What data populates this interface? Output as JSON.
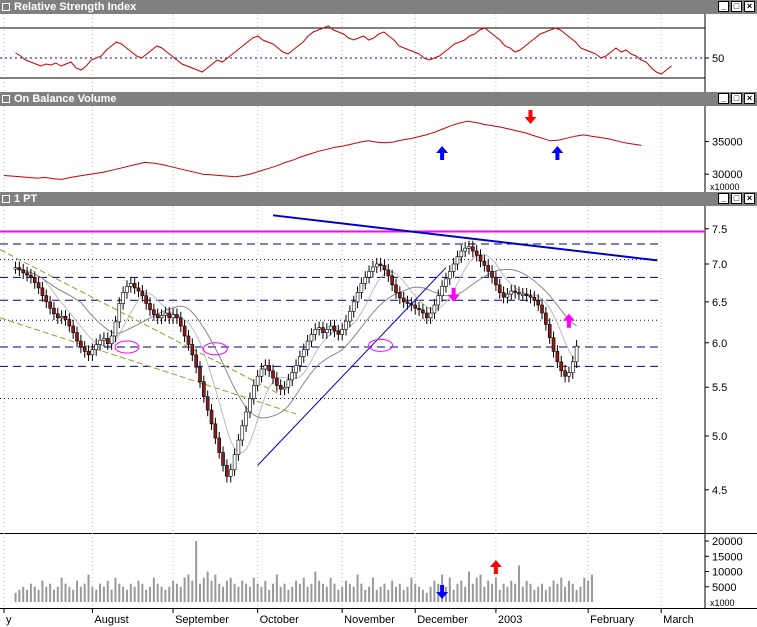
{
  "panels": {
    "rsi": {
      "title": "Relative Strength Index",
      "ticks": [
        {
          "v": 50,
          "label": "50"
        }
      ]
    },
    "obv": {
      "title": "On Balance Volume",
      "ticks": [
        {
          "v": 35000,
          "label": "35000"
        },
        {
          "v": 30000,
          "label": "30000"
        }
      ],
      "unit": "x10000"
    },
    "price": {
      "title": "1 PT",
      "ticks": [
        {
          "v": 7.5,
          "label": "7.5"
        },
        {
          "v": 7.0,
          "label": "7.0"
        },
        {
          "v": 6.5,
          "label": "6.5"
        },
        {
          "v": 6.0,
          "label": "6.0"
        },
        {
          "v": 5.5,
          "label": "5.5"
        },
        {
          "v": 5.0,
          "label": "5.0"
        },
        {
          "v": 4.5,
          "label": "4.5"
        }
      ]
    },
    "volume": {
      "ticks": [
        {
          "v": 20000,
          "label": "20000"
        },
        {
          "v": 15000,
          "label": "15000"
        },
        {
          "v": 10000,
          "label": "10000"
        },
        {
          "v": 5000,
          "label": "5000"
        }
      ],
      "unit": "x1000"
    }
  },
  "x_axis": {
    "months": [
      {
        "label": "y",
        "day": 0
      },
      {
        "label": "August",
        "day": 23
      },
      {
        "label": "September",
        "day": 44
      },
      {
        "label": "October",
        "day": 66
      },
      {
        "label": "November",
        "day": 88
      },
      {
        "label": "December",
        "day": 107
      },
      {
        "label": "2003",
        "day": 128
      },
      {
        "label": "February",
        "day": 152
      },
      {
        "label": "March",
        "day": 171
      }
    ]
  },
  "colors": {
    "rsi_line": "#cc0000",
    "obv_line": "#cc0000",
    "candle_up": "#ffffff",
    "candle_down": "#8b1a1a",
    "resistance": "#ff00ff",
    "trendline": "#0000cc",
    "channel": "#999933",
    "volume": "#999999",
    "arrow_blue": "#0000ff",
    "arrow_red": "#ff0000",
    "arrow_magenta": "#ff00ff"
  },
  "chart_data": {
    "type": "candlestick",
    "title": "1 PT",
    "days_total": 172,
    "ylim": [
      4.25,
      7.75
    ],
    "log_scale": true,
    "horizontal_lines": [
      {
        "v": 7.46,
        "style": "solid",
        "color": "magenta"
      },
      {
        "v": 7.28,
        "style": "dash"
      },
      {
        "v": 7.06,
        "style": "dot"
      },
      {
        "v": 6.82,
        "style": "dash"
      },
      {
        "v": 6.52,
        "style": "dash"
      },
      {
        "v": 6.27,
        "style": "dot"
      },
      {
        "v": 5.95,
        "style": "dash"
      },
      {
        "v": 5.73,
        "style": "dash"
      },
      {
        "v": 5.38,
        "style": "dot"
      }
    ],
    "price_close": [
      6.95,
      6.92,
      6.88,
      6.85,
      6.82,
      6.75,
      6.68,
      6.58,
      6.5,
      6.42,
      6.35,
      6.3,
      6.32,
      6.28,
      6.2,
      6.12,
      6.02,
      5.95,
      5.9,
      5.86,
      5.92,
      5.98,
      6.03,
      6.05,
      5.99,
      6.08,
      6.25,
      6.48,
      6.62,
      6.7,
      6.74,
      6.68,
      6.64,
      6.58,
      6.48,
      6.4,
      6.34,
      6.3,
      6.33,
      6.36,
      6.3,
      6.34,
      6.3,
      6.2,
      6.08,
      5.98,
      5.86,
      5.72,
      5.56,
      5.4,
      5.26,
      5.12,
      4.98,
      4.84,
      4.72,
      4.62,
      4.68,
      4.82,
      4.96,
      5.1,
      5.24,
      5.38,
      5.52,
      5.62,
      5.7,
      5.74,
      5.68,
      5.6,
      5.52,
      5.48,
      5.5,
      5.58,
      5.66,
      5.74,
      5.84,
      5.92,
      6.02,
      6.1,
      6.16,
      6.18,
      6.12,
      6.16,
      6.2,
      6.14,
      6.1,
      6.16,
      6.26,
      6.38,
      6.5,
      6.62,
      6.74,
      6.82,
      6.9,
      6.96,
      7.0,
      6.98,
      6.92,
      6.84,
      6.72,
      6.62,
      6.55,
      6.5,
      6.48,
      6.46,
      6.42,
      6.4,
      6.36,
      6.3,
      6.36,
      6.46,
      6.58,
      6.7,
      6.8,
      6.9,
      7.0,
      7.1,
      7.18,
      7.22,
      7.24,
      7.18,
      7.12,
      7.04,
      6.98,
      6.9,
      6.82,
      6.72,
      6.62,
      6.56,
      6.6,
      6.64,
      6.62,
      6.6,
      6.6,
      6.58,
      6.56,
      6.52,
      6.46,
      6.36,
      6.22,
      6.06,
      5.9,
      5.78,
      5.68,
      5.62,
      5.66,
      5.78,
      5.96
    ],
    "volume": [
      3,
      4,
      5,
      4,
      6,
      5,
      4,
      7,
      5,
      6,
      4,
      5,
      8,
      6,
      5,
      4,
      7,
      5,
      6,
      9,
      5,
      4,
      6,
      5,
      7,
      4,
      8,
      6,
      5,
      4,
      6,
      5,
      7,
      6,
      4,
      5,
      8,
      6,
      5,
      4,
      5,
      7,
      6,
      5,
      8,
      9,
      7,
      20,
      6,
      8,
      10,
      7,
      9,
      6,
      5,
      7,
      8,
      6,
      5,
      7,
      6,
      5,
      8,
      6,
      5,
      7,
      4,
      6,
      9,
      5,
      6,
      4,
      5,
      7,
      6,
      8,
      5,
      6,
      10,
      7,
      6,
      5,
      8,
      6,
      4,
      5,
      7,
      6,
      5,
      9,
      6,
      4,
      5,
      8,
      4,
      5,
      6,
      4,
      7,
      5,
      6,
      4,
      5,
      8,
      6,
      5,
      4,
      3,
      5,
      7,
      6,
      9,
      5,
      8,
      4,
      6,
      7,
      5,
      10,
      6,
      8,
      9,
      5,
      7,
      6,
      8,
      4,
      6,
      5,
      7,
      6,
      12,
      5,
      7,
      6,
      4,
      5,
      6,
      4,
      5,
      7,
      6,
      8,
      5,
      7,
      6,
      4,
      5,
      8,
      7,
      9
    ],
    "rsi": [
      55,
      52,
      48,
      46,
      44,
      42,
      44,
      43,
      45,
      42,
      44,
      46,
      40,
      38,
      42,
      48,
      50,
      52,
      58,
      62,
      66,
      64,
      60,
      56,
      52,
      50,
      54,
      58,
      62,
      60,
      56,
      52,
      48,
      44,
      42,
      40,
      38,
      36,
      40,
      44,
      48,
      46,
      50,
      54,
      58,
      62,
      66,
      70,
      72,
      68,
      66,
      64,
      60,
      56,
      54,
      58,
      62,
      66,
      72,
      76,
      78,
      80,
      82,
      78,
      76,
      74,
      70,
      68,
      70,
      72,
      68,
      70,
      74,
      76,
      72,
      68,
      62,
      60,
      58,
      56,
      54,
      50,
      48,
      50,
      52,
      56,
      60,
      64,
      66,
      68,
      72,
      74,
      78,
      80,
      76,
      72,
      68,
      62,
      60,
      56,
      58,
      62,
      66,
      70,
      74,
      76,
      78,
      80,
      78,
      74,
      70,
      66,
      60,
      58,
      56,
      54,
      50,
      52,
      56,
      60,
      56,
      58,
      54,
      52,
      48,
      46,
      40,
      36,
      34,
      38,
      42
    ],
    "obv": [
      29800,
      29700,
      29600,
      29500,
      29400,
      29500,
      29300,
      29200,
      29500,
      29700,
      29900,
      30100,
      30300,
      30600,
      30900,
      31200,
      31500,
      31800,
      31700,
      31500,
      31200,
      30900,
      30600,
      30300,
      30000,
      29900,
      29800,
      29700,
      29600,
      29800,
      30100,
      30500,
      30900,
      31300,
      31800,
      32200,
      32700,
      33100,
      33500,
      33800,
      34100,
      34300,
      34600,
      34900,
      35100,
      34900,
      34800,
      34900,
      35200,
      35400,
      35700,
      36000,
      36400,
      36900,
      37400,
      37800,
      38100,
      37900,
      37600,
      37400,
      37200,
      36900,
      36600,
      36300,
      35900,
      35500,
      35100,
      35200,
      35500,
      35800,
      36000,
      35800,
      35600,
      35400,
      35100,
      34800,
      34600,
      34400
    ]
  }
}
